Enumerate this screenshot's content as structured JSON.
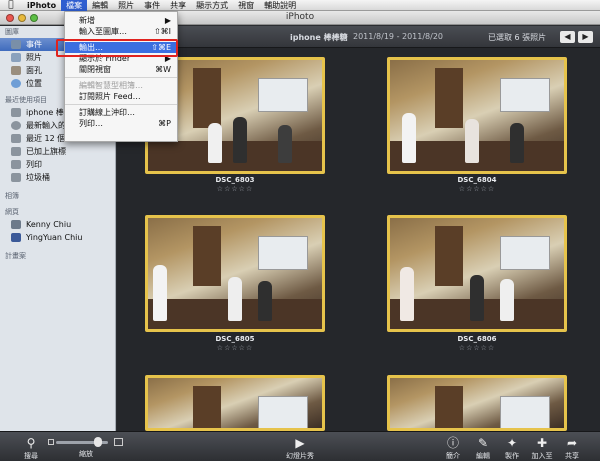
{
  "menubar": {
    "apple": "",
    "items": [
      "iPhoto",
      "檔案",
      "編輯",
      "照片",
      "事件",
      "共享",
      "顯示方式",
      "視窗",
      "輔助說明"
    ]
  },
  "window": {
    "title": "iPhoto"
  },
  "sidebar": {
    "library_header": "圖庫",
    "library": [
      {
        "label": "事件",
        "icon": "events-icon"
      },
      {
        "label": "照片",
        "icon": "photos-icon"
      },
      {
        "label": "面孔",
        "icon": "faces-icon"
      },
      {
        "label": "位置",
        "icon": "places-icon"
      }
    ],
    "recent_header": "最近使用項目",
    "recent": [
      {
        "label": "iphone 棒棒糖",
        "icon": "event-icon"
      },
      {
        "label": "最新輸入的項目",
        "icon": "import-icon"
      },
      {
        "label": "最近 12 個月",
        "icon": "calendar-icon"
      },
      {
        "label": "已加上旗標",
        "icon": "flag-icon"
      },
      {
        "label": "列印",
        "icon": "print-icon"
      },
      {
        "label": "垃圾桶",
        "icon": "trash-icon"
      }
    ],
    "albums_header": "相簿",
    "web_header": "網頁",
    "web": [
      {
        "label": "Kenny Chiu",
        "icon": "account-icon"
      },
      {
        "label": "YingYuan Chiu",
        "icon": "facebook-icon"
      }
    ],
    "projects_header": "計畫案"
  },
  "header": {
    "event_name": "iphone 棒棒糖",
    "date_range": "2011/8/19 - 2011/8/20",
    "selected": "已選取 6 張照片",
    "prev": "◀",
    "next": "▶"
  },
  "photos": [
    {
      "name": "DSC_6803",
      "rating": "☆☆☆☆☆"
    },
    {
      "name": "DSC_6804",
      "rating": "☆☆☆☆☆"
    },
    {
      "name": "DSC_6805",
      "rating": "☆☆☆☆☆"
    },
    {
      "name": "DSC_6806",
      "rating": "☆☆☆☆☆"
    },
    {
      "name": "",
      "rating": ""
    },
    {
      "name": "",
      "rating": ""
    }
  ],
  "file_menu": {
    "items": [
      {
        "label": "新增",
        "shortcut": "▶",
        "state": "normal"
      },
      {
        "label": "輸入至圖庫…",
        "shortcut": "⇧⌘I",
        "state": "normal"
      },
      {
        "label": "輸出…",
        "shortcut": "⇧⌘E",
        "state": "highlighted"
      },
      {
        "label": "顯示於 Finder",
        "shortcut": "▶",
        "state": "normal"
      },
      {
        "label": "關閉視窗",
        "shortcut": "⌘W",
        "state": "normal"
      },
      {
        "label": "編輯智慧型相簿…",
        "shortcut": "",
        "state": "disabled"
      },
      {
        "label": "訂閱照片 Feed…",
        "shortcut": "",
        "state": "normal"
      },
      {
        "label": "訂購線上沖印…",
        "shortcut": "",
        "state": "normal"
      },
      {
        "label": "列印…",
        "shortcut": "⌘P",
        "state": "normal"
      }
    ]
  },
  "toolbar": {
    "search": "搜尋",
    "zoom": "縮放",
    "slideshow": "幻燈片秀",
    "info": "簡介",
    "edit": "編輯",
    "create": "製作",
    "add_to": "加入至",
    "share": "共享"
  },
  "colors": {
    "selection_border": "#e6c34b",
    "menu_highlight": "#3b6ee0",
    "annotation_box": "#e0231f"
  }
}
